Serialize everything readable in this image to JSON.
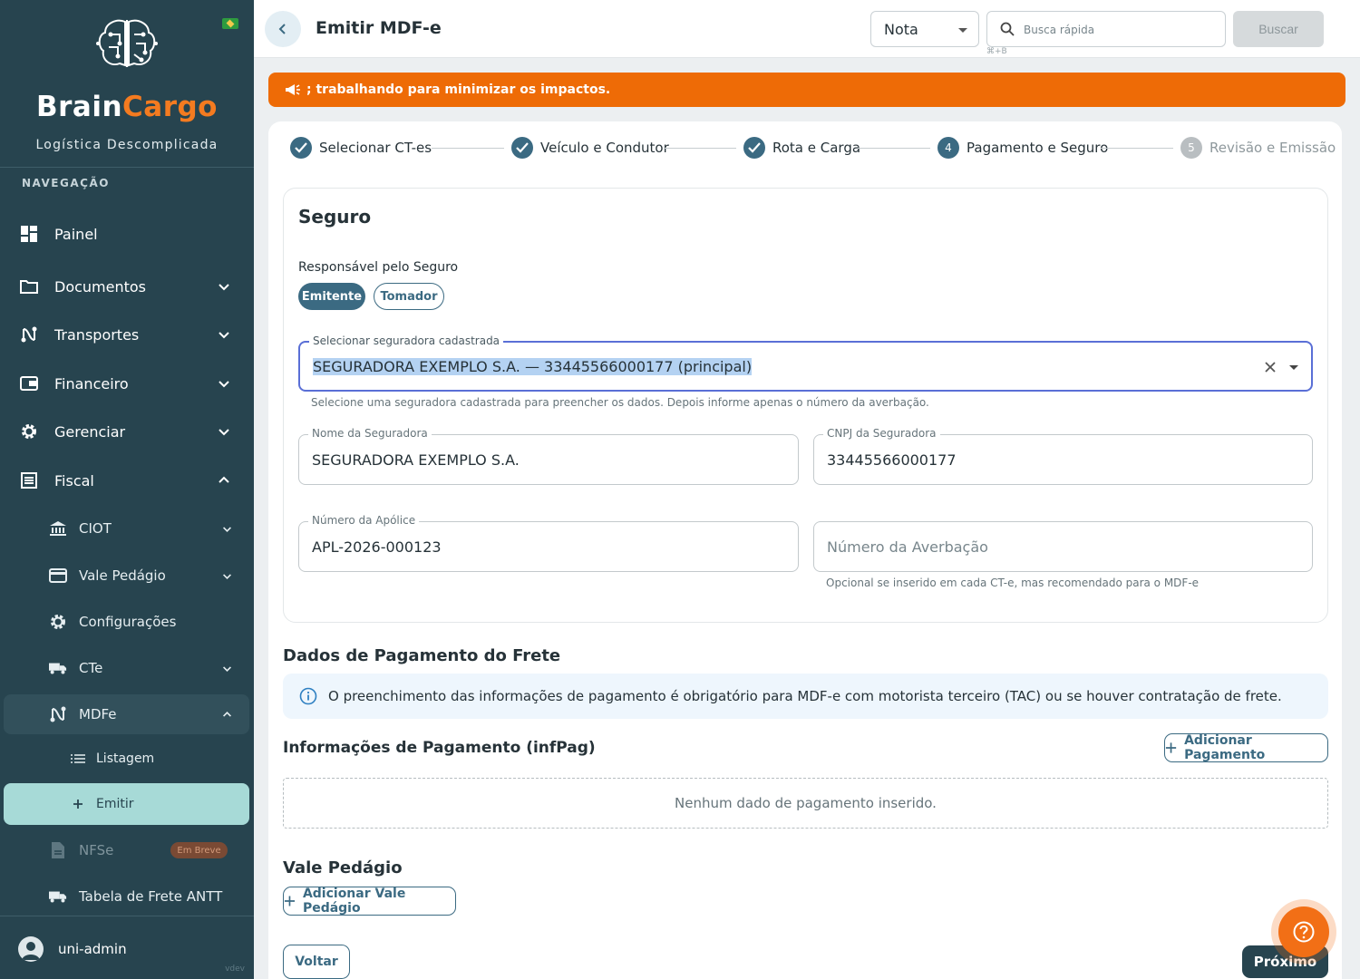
{
  "sidebar": {
    "brand_part1": "Brain",
    "brand_part2": "Cargo",
    "tagline": "Logística Descomplicada",
    "nav_heading": "NAVEGAÇÃO",
    "items": {
      "painel": "Painel",
      "documentos": "Documentos",
      "transportes": "Transportes",
      "financeiro": "Financeiro",
      "gerenciar": "Gerenciar",
      "fiscal": "Fiscal",
      "ciot": "CIOT",
      "vale_pedagio": "Vale Pedágio",
      "configuracoes": "Configurações",
      "cte": "CTe",
      "mdfe": "MDFe",
      "listagem": "Listagem",
      "emitir": "Emitir",
      "nfse": "NFSe",
      "nfse_badge": "Em Breve",
      "tabela_frete": "Tabela de Frete ANTT"
    },
    "user": "uni-admin",
    "version": "vdev"
  },
  "topbar": {
    "title": "Emitir MDF-e",
    "type_select": "Nota",
    "search_placeholder": "Busca rápida",
    "shortcut": "⌘+B",
    "search_button": "Buscar"
  },
  "banner": {
    "text": "; trabalhando para minimizar os impactos."
  },
  "stepper": {
    "steps": [
      {
        "label": "Selecionar CT-es",
        "state": "done"
      },
      {
        "label": "Veículo e Condutor",
        "state": "done"
      },
      {
        "label": "Rota e Carga",
        "state": "done"
      },
      {
        "label": "Pagamento e Seguro",
        "state": "current",
        "number": "4"
      },
      {
        "label": "Revisão e Emissão",
        "state": "pending",
        "number": "5"
      }
    ]
  },
  "seguro": {
    "heading": "Seguro",
    "responsavel_label": "Responsável pelo Seguro",
    "chip_emitente": "Emitente",
    "chip_tomador": "Tomador",
    "seguradora_select_label": "Selecionar seguradora cadastrada",
    "seguradora_select_value": "SEGURADORA EXEMPLO S.A. — 33445566000177 (principal)",
    "seguradora_select_helper": "Selecione uma seguradora cadastrada para preencher os dados. Depois informe apenas o número da averbação.",
    "nome_label": "Nome da Seguradora",
    "nome_value": "SEGURADORA EXEMPLO S.A.",
    "cnpj_label": "CNPJ da Seguradora",
    "cnpj_value": "33445566000177",
    "apolice_label": "Número da Apólice",
    "apolice_value": "APL-2026-000123",
    "averbacao_placeholder": "Número da Averbação",
    "averbacao_helper": "Opcional se inserido em cada CT-e, mas recomendado para o MDF-e"
  },
  "pagamento": {
    "heading": "Dados de Pagamento do Frete",
    "info": "O preenchimento das informações de pagamento é obrigatório para MDF-e com motorista terceiro (TAC) ou se houver contratação de frete.",
    "infpag_heading": "Informações de Pagamento (infPag)",
    "add_button": "Adicionar Pagamento",
    "empty": "Nenhum dado de pagamento inserido."
  },
  "vale_pedagio": {
    "heading": "Vale Pedágio",
    "add_button": "Adicionar Vale Pedágio"
  },
  "footer": {
    "back_button": "Voltar",
    "next_button": "Próximo"
  },
  "colors": {
    "sidebar_bg": "#27444f",
    "brand_orange": "#f47b20",
    "banner_orange": "#ee6b06",
    "primary": "#3b6a82",
    "active_nav": "#a7dad7"
  }
}
